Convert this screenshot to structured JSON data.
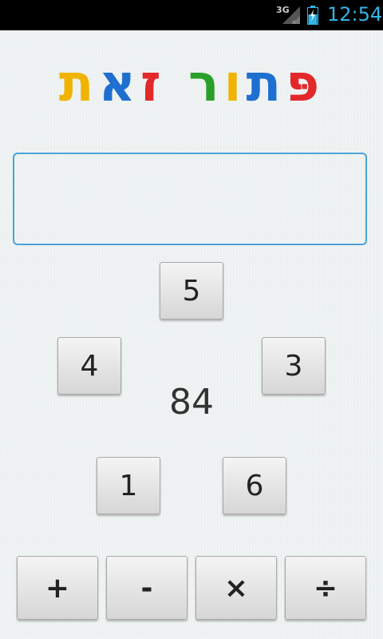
{
  "status_bar": {
    "network": "3G",
    "time": "12:54"
  },
  "title": {
    "letters": [
      {
        "char": "פּ",
        "color": "#e3282c"
      },
      {
        "char": "ת",
        "color": "#1e6fd0"
      },
      {
        "char": "ו",
        "color": "#f0b400"
      },
      {
        "char": "ר",
        "color": "#2aa02a"
      },
      {
        "char": " ",
        "color": "#000000"
      },
      {
        "char": "ז",
        "color": "#e3282c"
      },
      {
        "char": "א",
        "color": "#1e6fd0"
      },
      {
        "char": "ת",
        "color": "#f0b400"
      }
    ],
    "text": "פּתור זאת"
  },
  "answer": {
    "value": "",
    "placeholder": ""
  },
  "numbers": [
    "5",
    "4",
    "3",
    "1",
    "6"
  ],
  "target": "84",
  "operators": [
    "+",
    "-",
    "×",
    "÷"
  ]
}
